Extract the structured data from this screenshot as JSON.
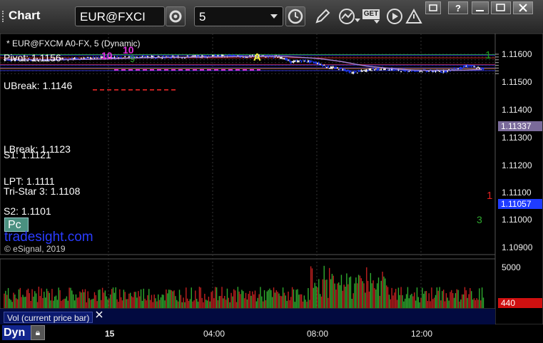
{
  "window": {
    "title": "Chart",
    "symbol_value": "EUR@FXCI",
    "interval_value": "5",
    "get_badge": "GET"
  },
  "chart": {
    "header": "* EUR@FXCM A0-FX, 5 (Dynamic)",
    "watermark": "tradesight.com",
    "copyright": "© eSignal, 2019",
    "pc_label": "Pc",
    "signal_A": "A",
    "signal_10a": "10",
    "signal_10b": "10",
    "signal_9": "9",
    "signal_1_red": "1",
    "signal_1_green": "1",
    "signal_3": "3",
    "level_labels": {
      "pivot": "Pivot: 1.1156",
      "ubreak": "UBreak: 1.1146",
      "lbreak": "LBreak: 1.1123",
      "s1": "S1: 1.1121",
      "lpt": "LPT: 1.1111",
      "tristar": "Tri-Star 3: 1.1108",
      "s2": "S2: 1.1101"
    },
    "price_axis": [
      "1.11600",
      "1.11500",
      "1.11400",
      "1.11300",
      "1.11200",
      "1.11100",
      "1.11000",
      "1.10900"
    ],
    "time_axis": [
      "15",
      "04:00",
      "08:00",
      "12:00"
    ],
    "ma_tag": "1.11337",
    "last_price_tag": "1.11057",
    "volume_axis": "5000",
    "volume_tag": "440",
    "volume_legend": "Vol (current price bar)",
    "bottom_label": "Dyn",
    "colors": {
      "up_candle": "#ffffff",
      "down_candle": "#1f3cff",
      "pivot_line": "#1f9d1f",
      "red_level": "#c02020",
      "blue_level": "#3030c8",
      "ma_line": "#a080d0",
      "volume_green": "#2faa2f",
      "volume_red": "#c02020"
    }
  }
}
